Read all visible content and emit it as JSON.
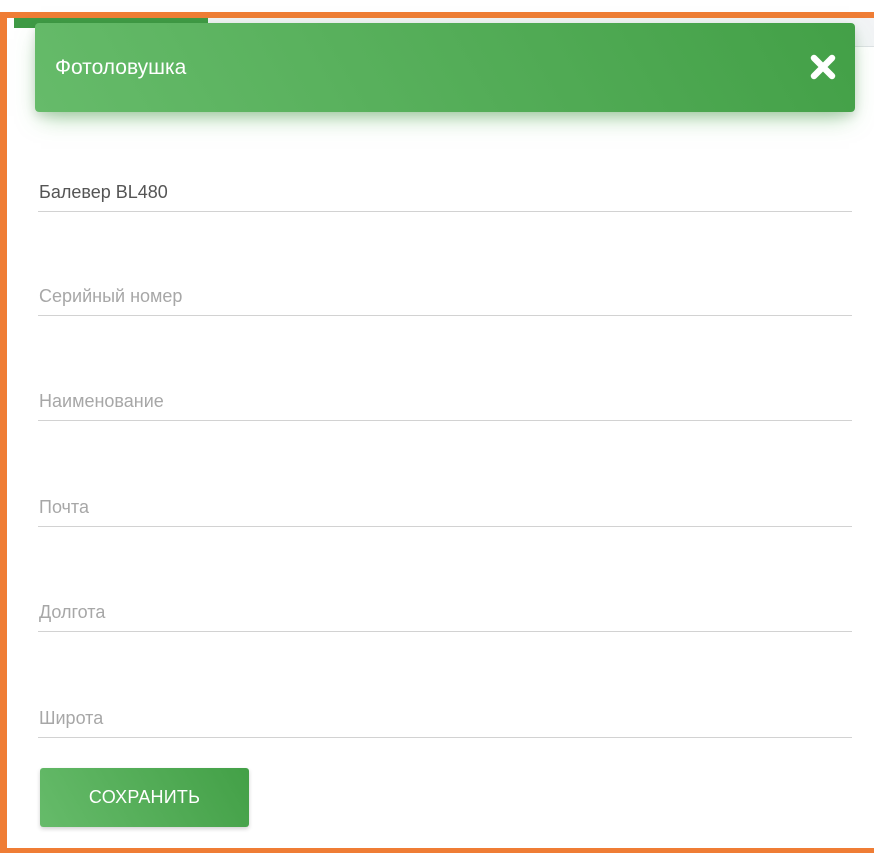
{
  "colors": {
    "accent_orange": "#ef7d35",
    "header_green_start": "#66bb6a",
    "header_green_end": "#43a047",
    "field_line": "#d2d2d2",
    "placeholder": "#a7a7a7",
    "value_text": "#555555"
  },
  "modal": {
    "title": "Фотоловушка",
    "close_icon": "close-icon"
  },
  "form": {
    "fields": [
      {
        "name": "model",
        "value": "Балевер BL480",
        "placeholder": ""
      },
      {
        "name": "serial_number",
        "value": "",
        "placeholder": "Серийный номер"
      },
      {
        "name": "title",
        "value": "",
        "placeholder": "Наименование"
      },
      {
        "name": "email",
        "value": "",
        "placeholder": "Почта"
      },
      {
        "name": "longitude",
        "value": "",
        "placeholder": "Долгота"
      },
      {
        "name": "latitude",
        "value": "",
        "placeholder": "Широта"
      }
    ],
    "save_label": "СОХРАНИТЬ"
  }
}
